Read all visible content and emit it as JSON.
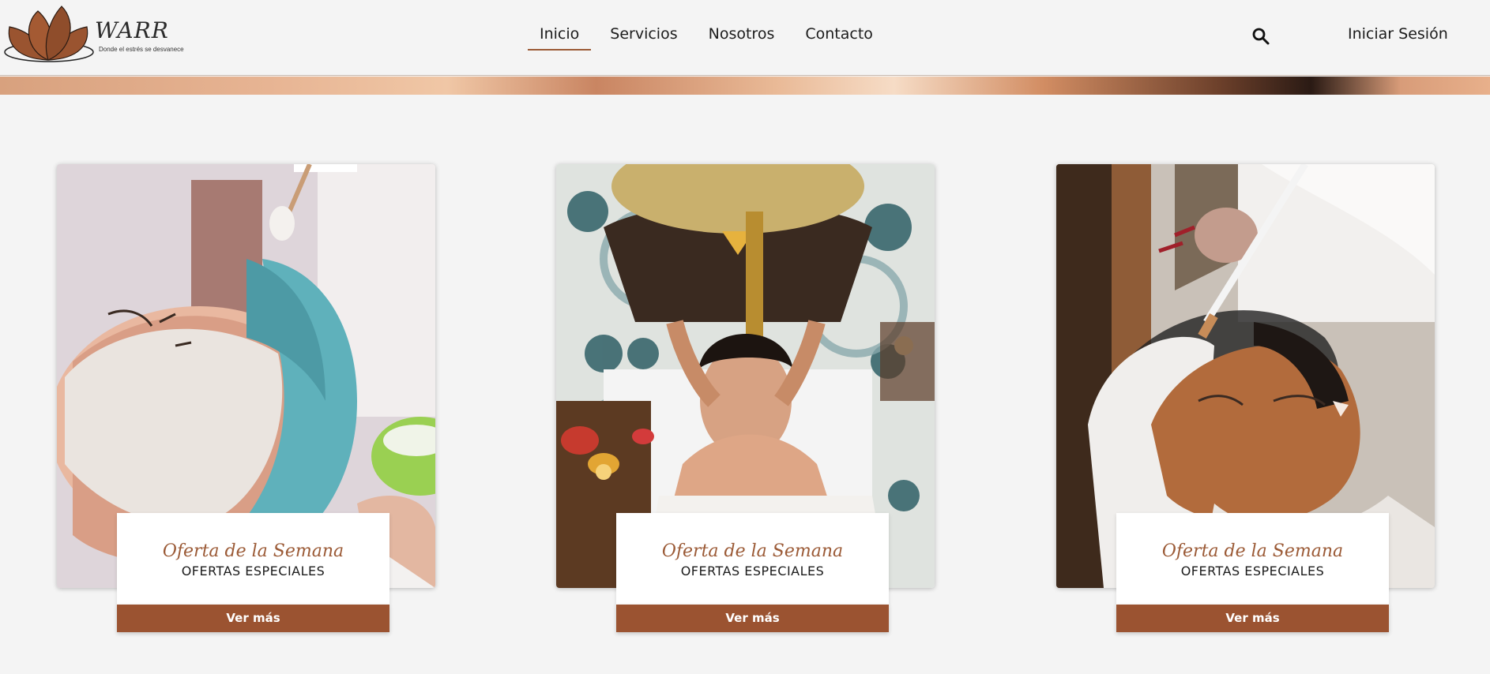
{
  "brand": {
    "name": "WARR",
    "tagline": "Donde el estrés se desvanece"
  },
  "nav": {
    "items": [
      {
        "label": "Inicio",
        "active": true
      },
      {
        "label": "Servicios",
        "active": false
      },
      {
        "label": "Nosotros",
        "active": false
      },
      {
        "label": "Contacto",
        "active": false
      }
    ]
  },
  "header": {
    "search_icon": "search-icon",
    "login_label": "Iniciar Sesión"
  },
  "cards": [
    {
      "image": "facial-mask-treatment-photo",
      "title": "Oferta de la Semana",
      "subtitle": "OFERTAS ESPECIALES",
      "button_label": "Ver más"
    },
    {
      "image": "head-massage-photo",
      "title": "Oferta de la Semana",
      "subtitle": "OFERTAS ESPECIALES",
      "button_label": "Ver más"
    },
    {
      "image": "clay-face-mask-photo",
      "title": "Oferta de la Semana",
      "subtitle": "OFERTAS ESPECIALES",
      "button_label": "Ver más"
    }
  ],
  "colors": {
    "accent": "#9b5a36",
    "button": "#9b5331",
    "background": "#f4f4f4"
  }
}
